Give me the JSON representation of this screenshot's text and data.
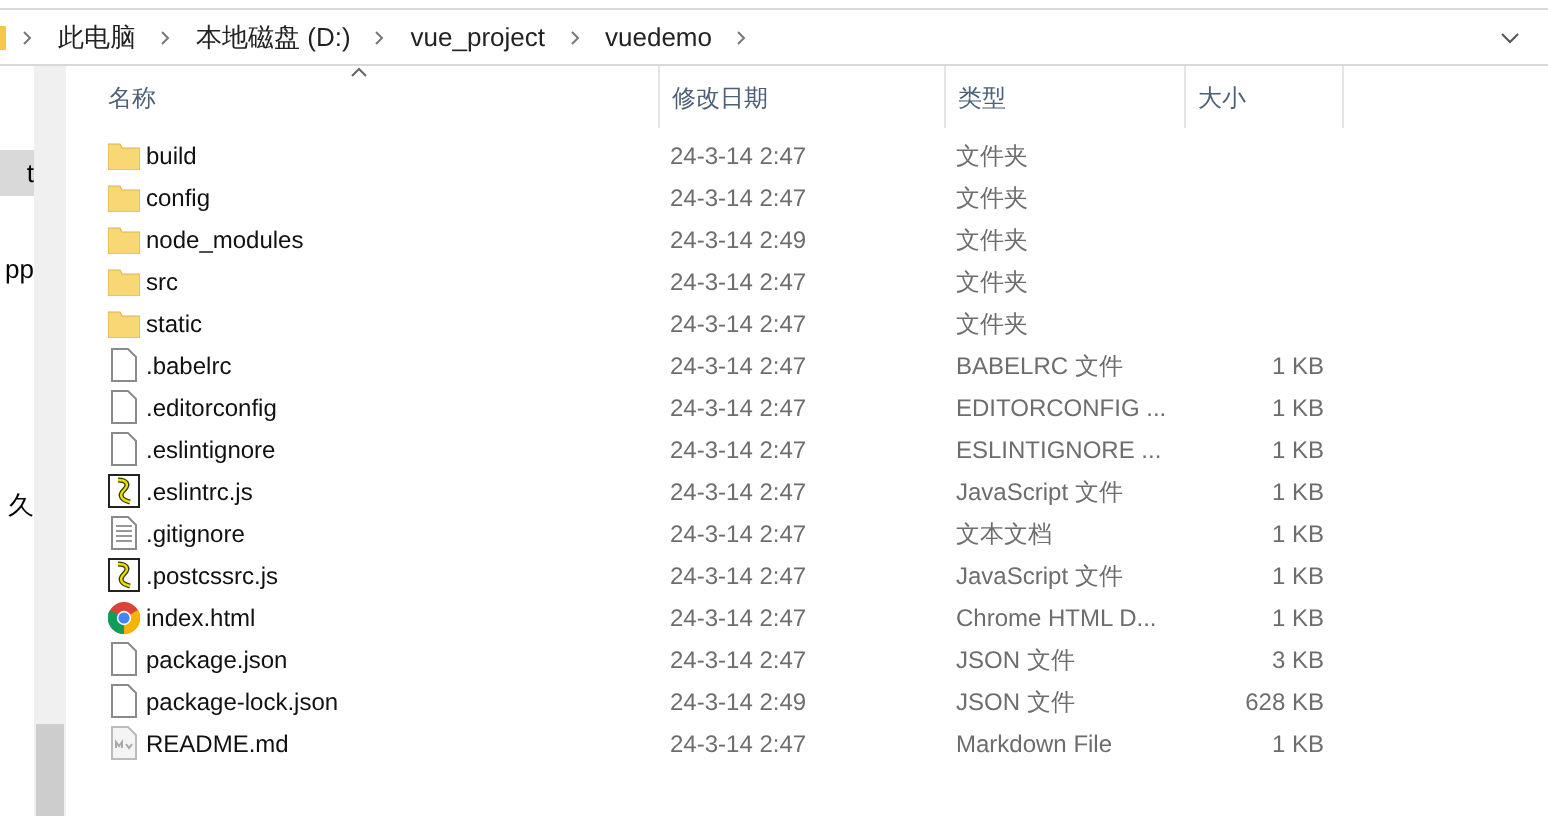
{
  "address_bar": {
    "path": [
      "此电脑",
      "本地磁盘 (D:)",
      "vue_project",
      "vuedemo"
    ]
  },
  "nav_pane": {
    "items": [
      {
        "label": "t",
        "selected": true
      },
      {
        "label": "pp",
        "selected": false
      },
      {
        "label": "久",
        "selected": false
      }
    ]
  },
  "table": {
    "columns": [
      "名称",
      "修改日期",
      "类型",
      "大小"
    ],
    "rows": [
      {
        "kind": "folder",
        "name": "build",
        "date": "24-3-14 2:47",
        "type": "文件夹"
      },
      {
        "kind": "folder",
        "name": "config",
        "date": "24-3-14 2:47",
        "type": "文件夹"
      },
      {
        "kind": "folder",
        "name": "node_modules",
        "date": "24-3-14 2:49",
        "type": "文件夹"
      },
      {
        "kind": "folder",
        "name": "src",
        "date": "24-3-14 2:47",
        "type": "文件夹"
      },
      {
        "kind": "folder",
        "name": "static",
        "date": "24-3-14 2:47",
        "type": "文件夹"
      },
      {
        "kind": "file",
        "name": ".babelrc",
        "date": "24-3-14 2:47",
        "type": "BABELRC 文件",
        "size": "1 KB"
      },
      {
        "kind": "file",
        "name": ".editorconfig",
        "date": "24-3-14 2:47",
        "type": "EDITORCONFIG ...",
        "size": "1 KB"
      },
      {
        "kind": "file",
        "name": ".eslintignore",
        "date": "24-3-14 2:47",
        "type": "ESLINTIGNORE ...",
        "size": "1 KB"
      },
      {
        "kind": "script",
        "name": ".eslintrc.js",
        "date": "24-3-14 2:47",
        "type": "JavaScript 文件",
        "size": "1 KB"
      },
      {
        "kind": "text",
        "name": ".gitignore",
        "date": "24-3-14 2:47",
        "type": "文本文档",
        "size": "1 KB"
      },
      {
        "kind": "script",
        "name": ".postcssrc.js",
        "date": "24-3-14 2:47",
        "type": "JavaScript 文件",
        "size": "1 KB"
      },
      {
        "kind": "browser",
        "name": "index.html",
        "date": "24-3-14 2:47",
        "type": "Chrome HTML D...",
        "size": "1 KB"
      },
      {
        "kind": "file",
        "name": "package.json",
        "date": "24-3-14 2:47",
        "type": "JSON 文件",
        "size": "3 KB"
      },
      {
        "kind": "file",
        "name": "package-lock.json",
        "date": "24-3-14 2:49",
        "type": "JSON 文件",
        "size": "628 KB"
      },
      {
        "kind": "markdown",
        "name": "README.md",
        "date": "24-3-14 2:47",
        "type": "Markdown File",
        "size": "1 KB"
      }
    ]
  }
}
